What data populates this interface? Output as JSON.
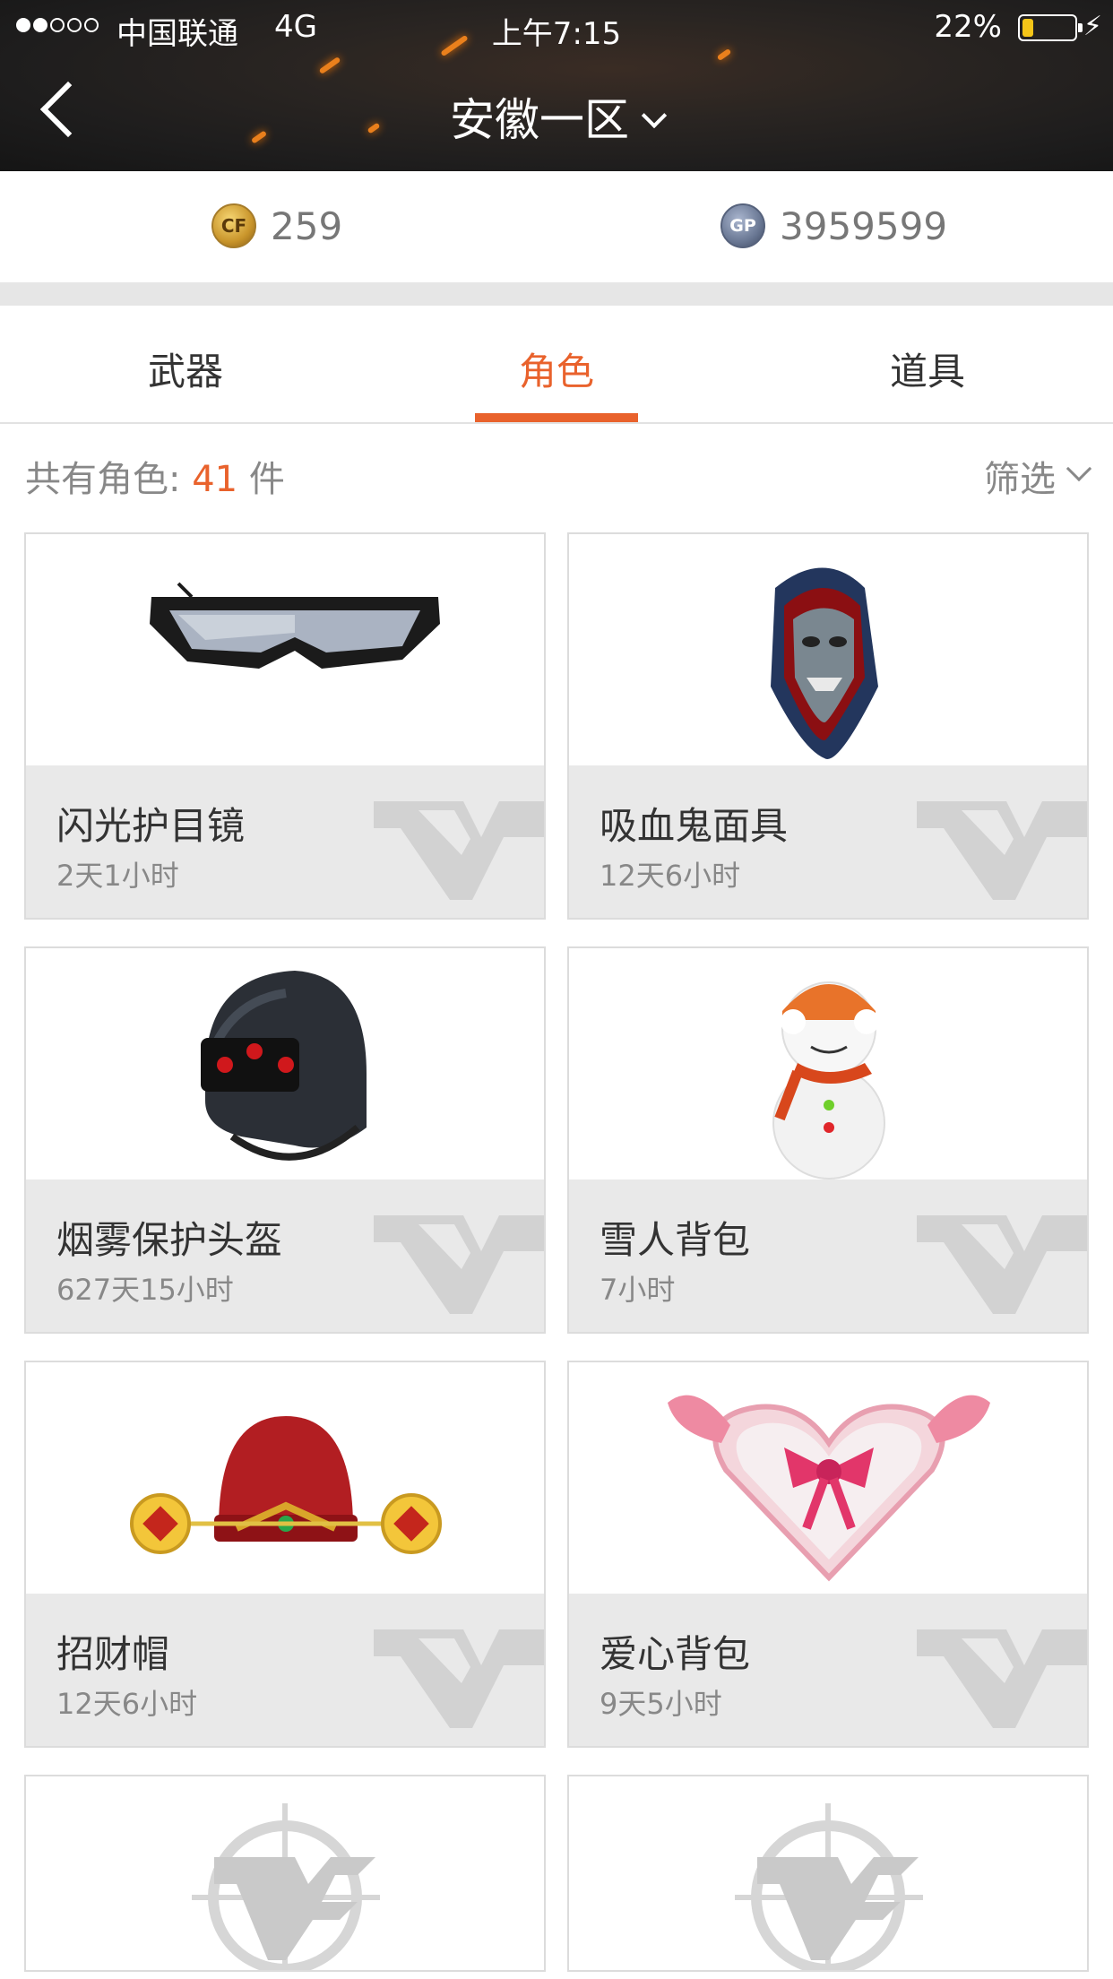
{
  "status_bar": {
    "carrier": "中国联通",
    "network": "4G",
    "time": "上午7:15",
    "battery": "22%",
    "battery_level": 0.22
  },
  "nav": {
    "title": "安徽一区"
  },
  "currency": {
    "cf_coins": "259",
    "gp": "3959599",
    "gp_label": "GP",
    "cf_label": "CF"
  },
  "tabs": [
    "武器",
    "角色",
    "道具"
  ],
  "active_tab": "角色",
  "summary": {
    "label": "共有角色:",
    "count": "41",
    "unit": "件",
    "filter_label": "筛选"
  },
  "items": [
    {
      "name": "闪光护目镜",
      "duration": "2天1小时",
      "icon": "goggles-icon"
    },
    {
      "name": "吸血鬼面具",
      "duration": "12天6小时",
      "icon": "vampire-mask-icon"
    },
    {
      "name": "烟雾保护头盔",
      "duration": "627天15小时",
      "icon": "helmet-icon"
    },
    {
      "name": "雪人背包",
      "duration": "7小时",
      "icon": "snowman-icon"
    },
    {
      "name": "招财帽",
      "duration": "12天6小时",
      "icon": "fortune-hat-icon"
    },
    {
      "name": "爱心背包",
      "duration": "9天5小时",
      "icon": "heart-backpack-icon"
    }
  ],
  "colors": {
    "accent": "#e9622c",
    "header_bg": "#1e1d1d",
    "card_info_bg": "#e9e9e9"
  }
}
